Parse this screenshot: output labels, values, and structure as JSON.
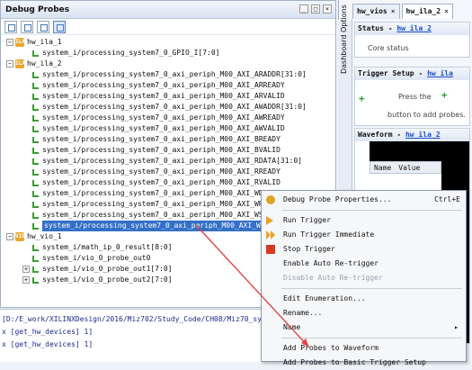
{
  "probes_panel": {
    "title": "Debug Probes",
    "tree": [
      {
        "level": 1,
        "type": "ila",
        "label": "hw_ila_1"
      },
      {
        "level": 2,
        "type": "probe",
        "label": "system_i/processing_system7_0_GPIO_I[7:0]"
      },
      {
        "level": 1,
        "type": "ila",
        "label": "hw_ila_2"
      },
      {
        "level": 2,
        "type": "probe",
        "label": "system_i/processing_system7_0_axi_periph_M00_AXI_ARADDR[31:0]"
      },
      {
        "level": 2,
        "type": "probe",
        "label": "system_i/processing_system7_0_axi_periph_M00_AXI_ARREADY"
      },
      {
        "level": 2,
        "type": "probe",
        "label": "system_i/processing_system7_0_axi_periph_M00_AXI_ARVALID"
      },
      {
        "level": 2,
        "type": "probe",
        "label": "system_i/processing_system7_0_axi_periph_M00_AXI_AWADDR[31:0]"
      },
      {
        "level": 2,
        "type": "probe",
        "label": "system_i/processing_system7_0_axi_periph_M00_AXI_AWREADY"
      },
      {
        "level": 2,
        "type": "probe",
        "label": "system_i/processing_system7_0_axi_periph_M00_AXI_AWVALID"
      },
      {
        "level": 2,
        "type": "probe",
        "label": "system_i/processing_system7_0_axi_periph_M00_AXI_BREADY"
      },
      {
        "level": 2,
        "type": "probe",
        "label": "system_i/processing_system7_0_axi_periph_M00_AXI_BVALID"
      },
      {
        "level": 2,
        "type": "probe",
        "label": "system_i/processing_system7_0_axi_periph_M00_AXI_RDATA[31:0]"
      },
      {
        "level": 2,
        "type": "probe",
        "label": "system_i/processing_system7_0_axi_periph_M00_AXI_RREADY"
      },
      {
        "level": 2,
        "type": "probe",
        "label": "system_i/processing_system7_0_axi_periph_M00_AXI_RVALID"
      },
      {
        "level": 2,
        "type": "probe",
        "label": "system_i/processing_system7_0_axi_periph_M00_AXI_WDATA[31:0]"
      },
      {
        "level": 2,
        "type": "probe",
        "label": "system_i/processing_system7_0_axi_periph_M00_AXI_WREADY"
      },
      {
        "level": 2,
        "type": "probe",
        "label": "system_i/processing_system7_0_axi_periph_M00_AXI_WSTRB[3"
      },
      {
        "level": 2,
        "type": "probe",
        "label": "system_i/processing_system7_0_axi_periph_M00_AXI_WVALID",
        "selected": true
      },
      {
        "level": 1,
        "type": "vio",
        "label": "hw_vio_1"
      },
      {
        "level": 2,
        "type": "probe",
        "label": "system_i/math_ip_0_result[8:0]"
      },
      {
        "level": 2,
        "type": "probe",
        "label": "system_i/vio_0_probe_out0"
      },
      {
        "level": 2,
        "type": "probe",
        "label": "system_i/vio_0_probe_out1[7:0]",
        "expandable": true
      },
      {
        "level": 2,
        "type": "probe",
        "label": "system_i/vio_0_probe_out2[7:0]",
        "expandable": true
      }
    ]
  },
  "console": {
    "lines": [
      "[D:/E_work/XILINXDesign/2016/Miz702/Study_Code/CH08/Miz70_sys/Mi",
      "x [get_hw_devices] 1]",
      "x [get_hw_devices] 1]"
    ]
  },
  "right_panel": {
    "tabs": [
      {
        "label": "hw_vios",
        "active": false
      },
      {
        "label": "hw_ila_2",
        "active": true
      }
    ],
    "vertical_tab": "Dashboard Options",
    "status": {
      "label": "Status - ",
      "link": "hw ila 2",
      "body": "Core status"
    },
    "trigger_setup": {
      "label": "Trigger Setup - ",
      "link": "hw ila",
      "press": "Press the",
      "add": "button to add probes."
    },
    "waveform": {
      "label": "Waveform - ",
      "link": "hw ila 2",
      "col_name": "Name",
      "col_value": "Value"
    }
  },
  "context_menu": {
    "items": [
      {
        "label": "Debug Probe Properties...",
        "shortcut": "Ctrl+E",
        "icon": "gear-icon"
      },
      {
        "sep": true
      },
      {
        "label": "Run Trigger",
        "icon": "run-icon"
      },
      {
        "label": "Run Trigger Immediate",
        "icon": "run-immediate-icon"
      },
      {
        "label": "Stop Trigger",
        "icon": "stop-icon"
      },
      {
        "label": "Enable Auto Re-trigger"
      },
      {
        "label": "Disable Auto Re-trigger",
        "disabled": true
      },
      {
        "sep": true
      },
      {
        "label": "Edit Enumeration..."
      },
      {
        "label": "Rename..."
      },
      {
        "label": "Name",
        "submenu": true
      },
      {
        "sep": true
      },
      {
        "label": "Add Probes to Waveform"
      },
      {
        "label": "Add Probes to Basic Trigger Setup"
      }
    ]
  },
  "colors": {
    "selection": "#3370c7",
    "arrow": "#e04444",
    "probe": "#3f9a35",
    "ila": "#e7a72d"
  }
}
